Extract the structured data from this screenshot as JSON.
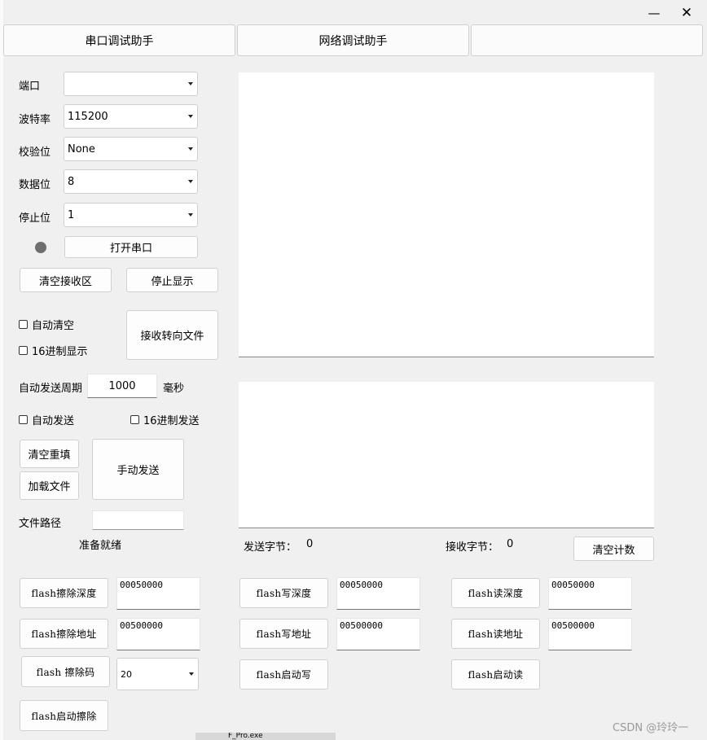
{
  "window": {
    "minimize_glyph": "—",
    "close_glyph": "✕"
  },
  "tabs": [
    {
      "label": "串口调试助手"
    },
    {
      "label": "网络调试助手"
    },
    {
      "label": ""
    }
  ],
  "serial": {
    "port_label": "端口",
    "port_value": "",
    "baud_label": "波特率",
    "baud_value": "115200",
    "parity_label": "校验位",
    "parity_value": "None",
    "databits_label": "数据位",
    "databits_value": "8",
    "stopbits_label": "停止位",
    "stopbits_value": "1",
    "open_button": "打开串口",
    "status_color": "#6e6e6e"
  },
  "receive": {
    "clear_button": "清空接收区",
    "stop_display_button": "停止显示",
    "auto_clear_label": "自动清空",
    "hex_display_label": "16进制显示",
    "redirect_button": "接收转向文件"
  },
  "send": {
    "period_label": "自动发送周期",
    "period_value": "1000",
    "period_unit": "毫秒",
    "auto_send_label": "自动发送",
    "hex_send_label": "16进制发送",
    "clear_refill_button": "清空重填",
    "load_file_button": "加载文件",
    "manual_send_button": "手动发送",
    "file_path_label": "文件路径",
    "file_path_value": "",
    "status_text": "准备就绪"
  },
  "counters": {
    "sent_label": "发送字节：",
    "sent_value": "0",
    "recv_label": "接收字节：",
    "recv_value": "0",
    "clear_button": "清空计数"
  },
  "flash": {
    "erase_depth_button": "flash擦除深度",
    "erase_depth_value": "00050000",
    "erase_addr_button": "flash擦除地址",
    "erase_addr_value": "00500000",
    "erase_code_button": "flash 擦除码",
    "erase_code_value": "20",
    "erase_start_button": "flash启动擦除",
    "write_depth_button": "flash写深度",
    "write_depth_value": "00050000",
    "write_addr_button": "flash写地址",
    "write_addr_value": "00500000",
    "write_start_button": "flash启动写",
    "read_depth_button": "flash读深度",
    "read_depth_value": "00050000",
    "read_addr_button": "flash读地址",
    "read_addr_value": "00500000",
    "read_start_button": "flash启动读"
  },
  "background_fragment": "F_Pro.exe",
  "watermark": "CSDN @玲玲一"
}
